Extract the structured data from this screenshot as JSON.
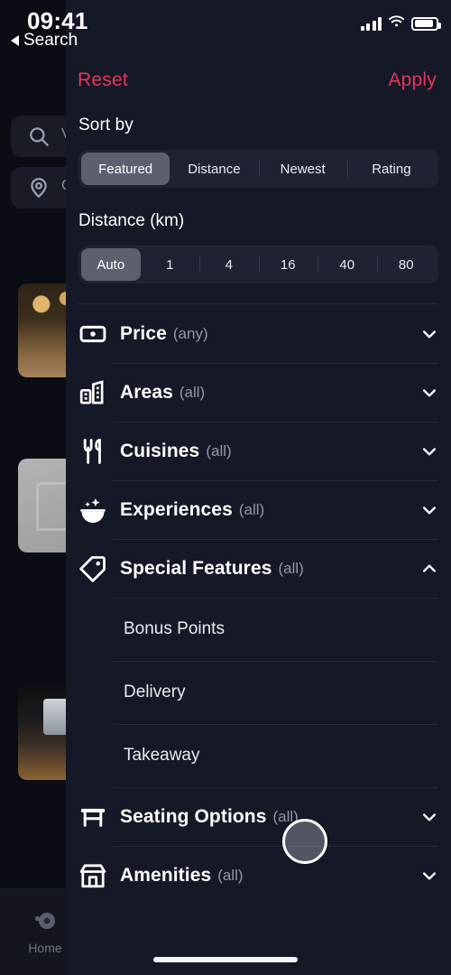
{
  "status_bar": {
    "time": "09:41",
    "back_label": "Search",
    "icons": [
      "cellular-signal-icon",
      "wifi-icon",
      "battery-icon"
    ]
  },
  "background": {
    "search_value": "V",
    "location_value": "C",
    "tab_label": "Home",
    "cards": [
      "restaurant-photo-1",
      "restaurant-photo-2",
      "restaurant-photo-3"
    ]
  },
  "header": {
    "reset_label": "Reset",
    "apply_label": "Apply",
    "accent_color": "#e8365a"
  },
  "sort": {
    "label": "Sort by",
    "options": [
      "Featured",
      "Distance",
      "Newest",
      "Rating"
    ],
    "selected": "Featured"
  },
  "distance": {
    "label": "Distance (km)",
    "options": [
      "Auto",
      "1",
      "4",
      "16",
      "40",
      "80"
    ],
    "selected": "Auto"
  },
  "filters": [
    {
      "title": "Price",
      "value": "(any)",
      "icon": "banknote-icon",
      "expanded": false,
      "chevron": "chevron-down-icon"
    },
    {
      "title": "Areas",
      "value": "(all)",
      "icon": "building-icon",
      "expanded": false,
      "chevron": "chevron-down-icon"
    },
    {
      "title": "Cuisines",
      "value": "(all)",
      "icon": "utensils-icon",
      "expanded": false,
      "chevron": "chevron-down-icon"
    },
    {
      "title": "Experiences",
      "value": "(all)",
      "icon": "sparkle-bowl-icon",
      "expanded": false,
      "chevron": "chevron-down-icon"
    },
    {
      "title": "Special Features",
      "value": "(all)",
      "icon": "tag-icon",
      "expanded": true,
      "chevron": "chevron-up-icon"
    },
    {
      "title": "Seating Options",
      "value": "(all)",
      "icon": "table-icon",
      "expanded": false,
      "chevron": "chevron-down-icon"
    },
    {
      "title": "Amenities",
      "value": "(all)",
      "icon": "storefront-icon",
      "expanded": false,
      "chevron": "chevron-down-icon"
    }
  ],
  "special_features_options": [
    "Bonus Points",
    "Delivery",
    "Takeaway"
  ],
  "colors": {
    "sheet_bg": "#151826",
    "segment_track": "#1e2232",
    "segment_active": "#5c5f6e",
    "divider": "#272b3a",
    "muted_text": "#9298a8"
  }
}
